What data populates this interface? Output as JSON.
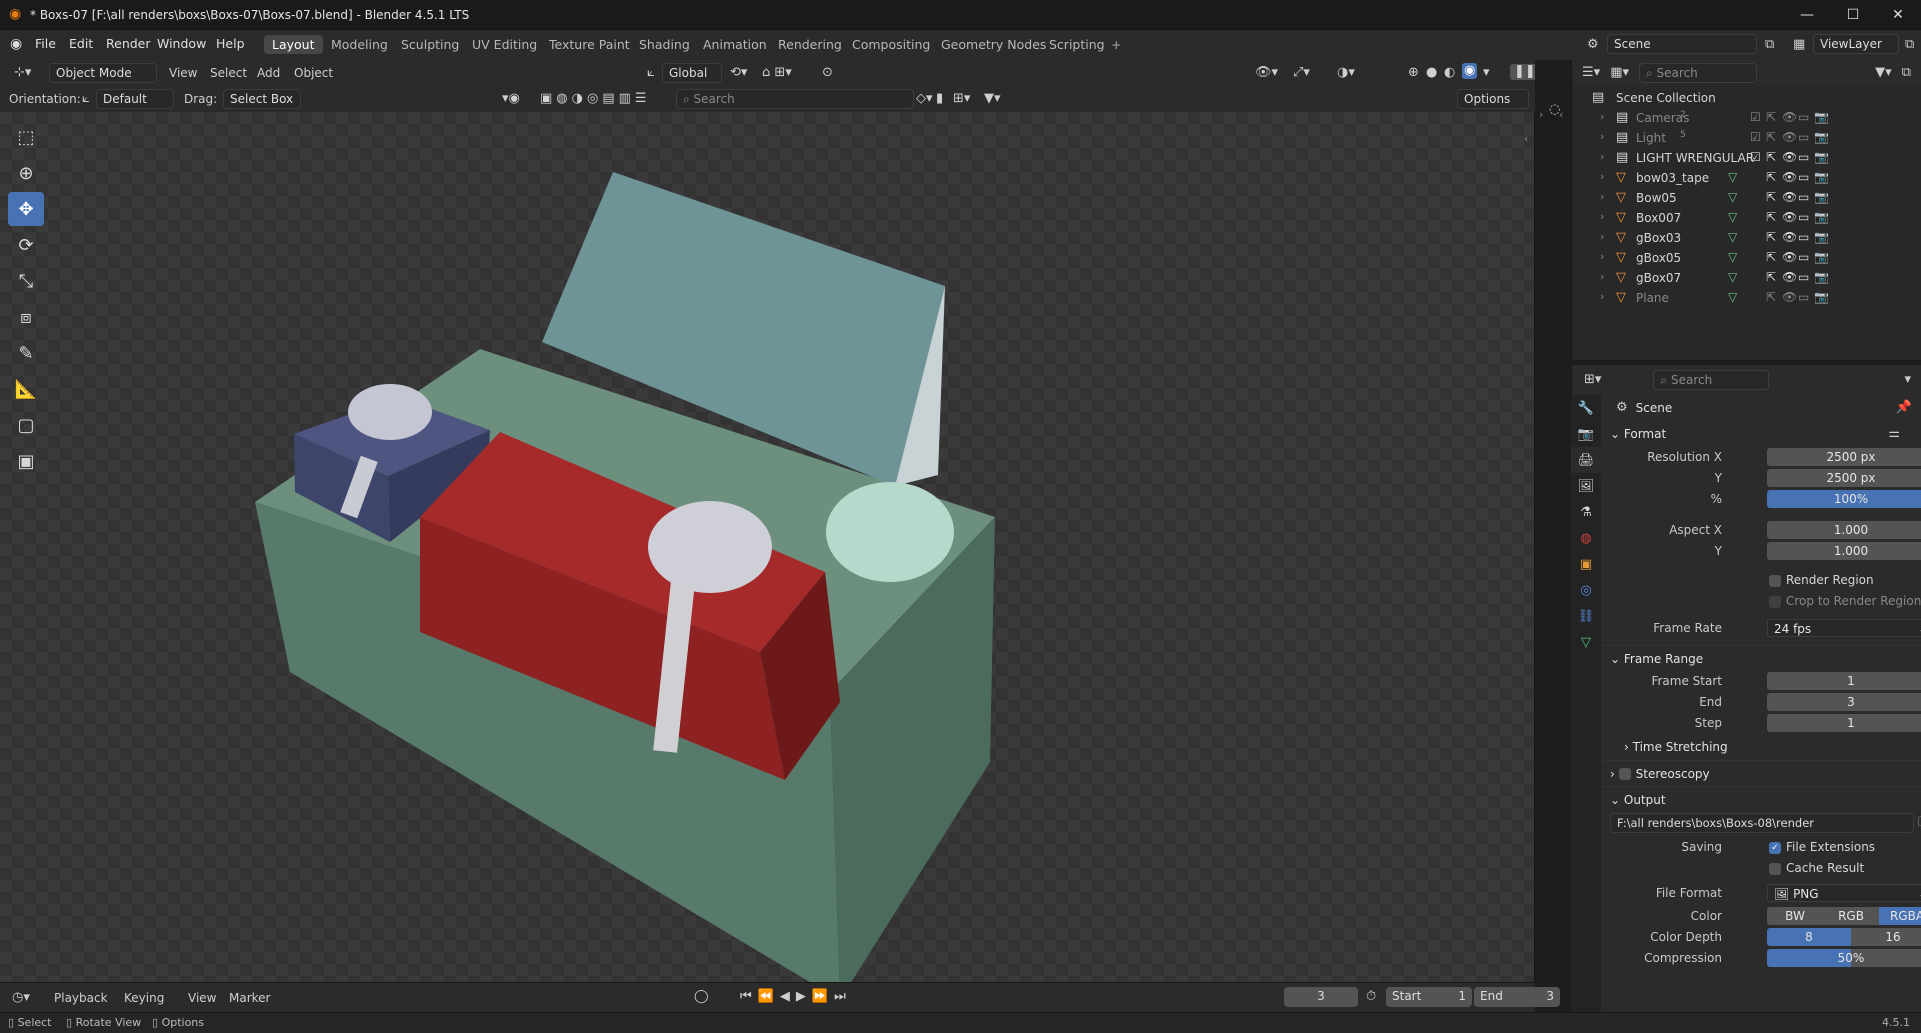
{
  "window": {
    "title": "* Boxs-07 [F:\\all renders\\boxs\\Boxs-07\\Boxs-07.blend] - Blender 4.5.1 LTS"
  },
  "menu": [
    "File",
    "Edit",
    "Render",
    "Window",
    "Help"
  ],
  "workspaces": [
    "Layout",
    "Modeling",
    "Sculpting",
    "UV Editing",
    "Texture Paint",
    "Shading",
    "Animation",
    "Rendering",
    "Compositing",
    "Geometry Nodes",
    "Scripting"
  ],
  "workspace_active": "Layout",
  "header": {
    "mode": "Object Mode",
    "view": "View",
    "select": "Select",
    "add": "Add",
    "object": "Object",
    "transform_space": "Global",
    "orientation_label": "Orientation:",
    "orientation": "Default",
    "drag_label": "Drag:",
    "drag": "Select Box",
    "search_placeholder": "Search",
    "options": "Options"
  },
  "right_top": {
    "scene": "Scene",
    "viewlayer": "ViewLayer"
  },
  "outliner": {
    "search_placeholder": "Search",
    "root": "Scene Collection",
    "items": [
      {
        "name": "Cameras",
        "kind": "collection",
        "badge": "2",
        "dim": true
      },
      {
        "name": "Light",
        "kind": "collection",
        "badge": "5",
        "dim": true
      },
      {
        "name": "LIGHT WRENGULAR",
        "kind": "collection",
        "badge": "",
        "dim": false
      },
      {
        "name": "bow03_tape",
        "kind": "object",
        "badge": "",
        "dim": false
      },
      {
        "name": "Bow05",
        "kind": "object",
        "badge": "",
        "dim": false
      },
      {
        "name": "Box007",
        "kind": "object",
        "badge": "",
        "dim": false
      },
      {
        "name": "gBox03",
        "kind": "object",
        "badge": "",
        "dim": false
      },
      {
        "name": "gBox05",
        "kind": "object",
        "badge": "",
        "dim": false
      },
      {
        "name": "gBox07",
        "kind": "object",
        "badge": "",
        "dim": false
      },
      {
        "name": "Plane",
        "kind": "object",
        "badge": "",
        "dim": true
      }
    ]
  },
  "properties": {
    "search_placeholder": "Search",
    "context": "Scene",
    "format": {
      "title": "Format",
      "res_x_label": "Resolution X",
      "res_x": "2500 px",
      "res_y_label": "Y",
      "res_y": "2500 px",
      "pct_label": "%",
      "pct": "100%",
      "aspect_x_label": "Aspect X",
      "aspect_x": "1.000",
      "aspect_y_label": "Y",
      "aspect_y": "1.000",
      "render_region": "Render Region",
      "crop": "Crop to Render Region",
      "frame_rate_label": "Frame Rate",
      "frame_rate": "24 fps"
    },
    "frame_range": {
      "title": "Frame Range",
      "start_label": "Frame Start",
      "start": "1",
      "end_label": "End",
      "end": "3",
      "step_label": "Step",
      "step": "1",
      "time_stretching": "Time Stretching"
    },
    "stereoscopy": "Stereoscopy",
    "output": {
      "title": "Output",
      "path": "F:\\all renders\\boxs\\Boxs-08\\render",
      "saving_label": "Saving",
      "file_ext": "File Extensions",
      "cache": "Cache Result",
      "format_label": "File Format",
      "format": "PNG",
      "color_label": "Color",
      "color_opts": [
        "BW",
        "RGB",
        "RGBA"
      ],
      "color_active": "RGBA",
      "depth_label": "Color Depth",
      "depth_opts": [
        "8",
        "16"
      ],
      "depth_active": "8",
      "compression_label": "Compression",
      "compression": "50%"
    }
  },
  "timeline": {
    "playback": "Playback",
    "keying": "Keying",
    "view": "View",
    "marker": "Marker",
    "current": "3",
    "start_label": "Start",
    "start": "1",
    "end_label": "End",
    "end": "3"
  },
  "status": {
    "select": "Select",
    "rotate": "Rotate View",
    "options": "Options",
    "version": "4.5.1"
  },
  "colors": {
    "accent": "#4772b3",
    "bg": "#1d1d1d",
    "panel": "#2b2b2b"
  }
}
